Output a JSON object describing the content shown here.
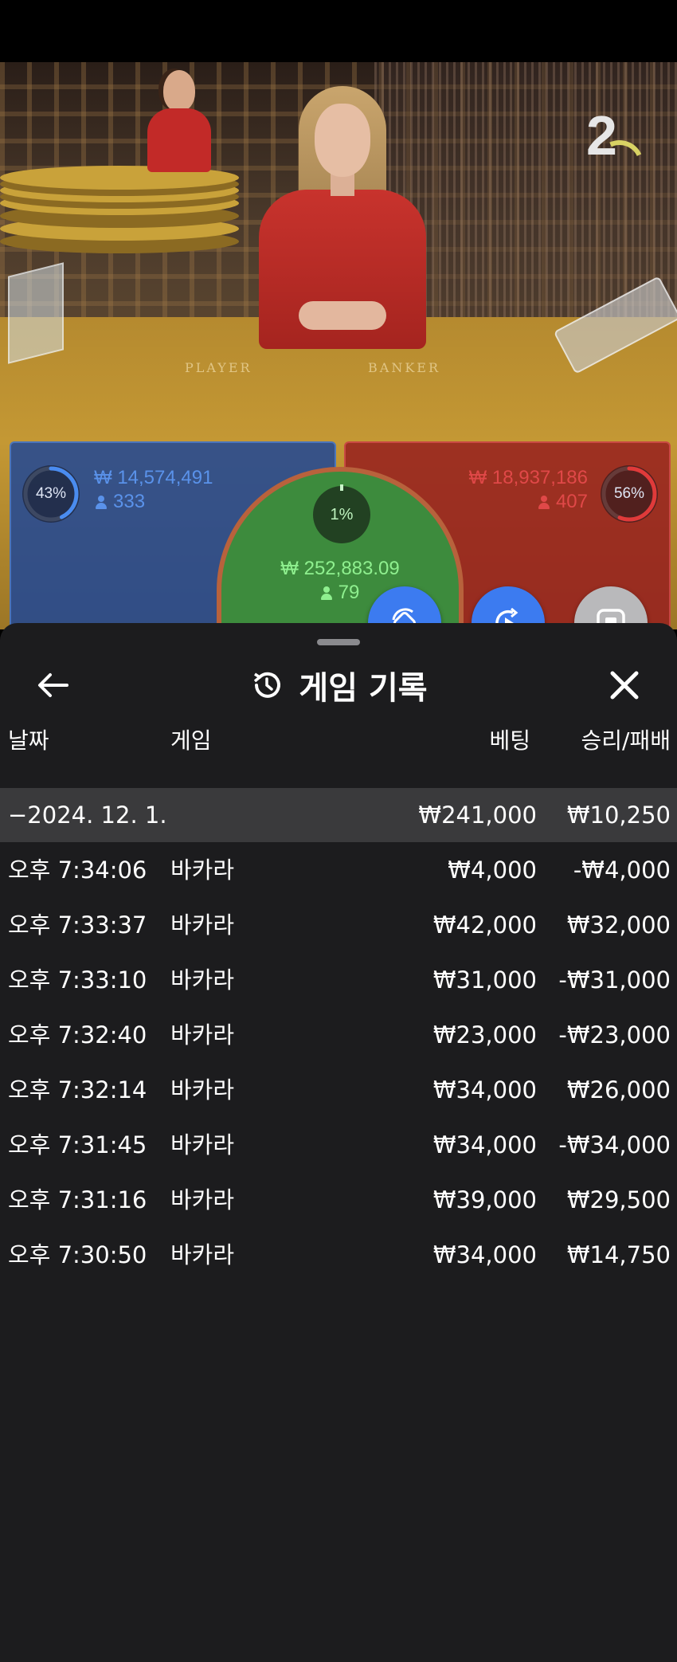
{
  "live": {
    "round_number": "2",
    "table_labels": {
      "player": "PLAYER",
      "banker": "BANKER"
    },
    "player": {
      "percent": "43%",
      "percent_value": 0.43,
      "amount": "₩ 14,574,491",
      "bettors": "333",
      "color": "#3f7fe0"
    },
    "banker": {
      "percent": "56%",
      "percent_value": 0.56,
      "amount": "₩ 18,937,186",
      "bettors": "407",
      "color": "#e03a3a"
    },
    "tie": {
      "percent": "1%",
      "amount": "₩ 252,883.09",
      "bettors": "79",
      "color": "#6fd36f"
    }
  },
  "controls": {
    "swap_icon": "swap-icon",
    "play_icon": "replay-play-icon",
    "stop_icon": "stop-icon"
  },
  "history": {
    "title": "게임 기록",
    "back_icon": "arrow-left-icon",
    "history_icon": "history-icon",
    "close_icon": "close-icon",
    "columns": {
      "date": "날짜",
      "game": "게임",
      "bet": "베팅",
      "result": "승리/패배"
    },
    "date_group": {
      "label": "−2024. 12. 1.",
      "bet": "₩241,000",
      "result": "₩10,250"
    },
    "rows": [
      {
        "time": "오후 7:34:06",
        "game": "바카라",
        "bet": "₩4,000",
        "result": "-₩4,000"
      },
      {
        "time": "오후 7:33:37",
        "game": "바카라",
        "bet": "₩42,000",
        "result": "₩32,000"
      },
      {
        "time": "오후 7:33:10",
        "game": "바카라",
        "bet": "₩31,000",
        "result": "-₩31,000"
      },
      {
        "time": "오후 7:32:40",
        "game": "바카라",
        "bet": "₩23,000",
        "result": "-₩23,000"
      },
      {
        "time": "오후 7:32:14",
        "game": "바카라",
        "bet": "₩34,000",
        "result": "₩26,000"
      },
      {
        "time": "오후 7:31:45",
        "game": "바카라",
        "bet": "₩34,000",
        "result": "-₩34,000"
      },
      {
        "time": "오후 7:31:16",
        "game": "바카라",
        "bet": "₩39,000",
        "result": "₩29,500"
      },
      {
        "time": "오후 7:30:50",
        "game": "바카라",
        "bet": "₩34,000",
        "result": "₩14,750"
      }
    ]
  }
}
